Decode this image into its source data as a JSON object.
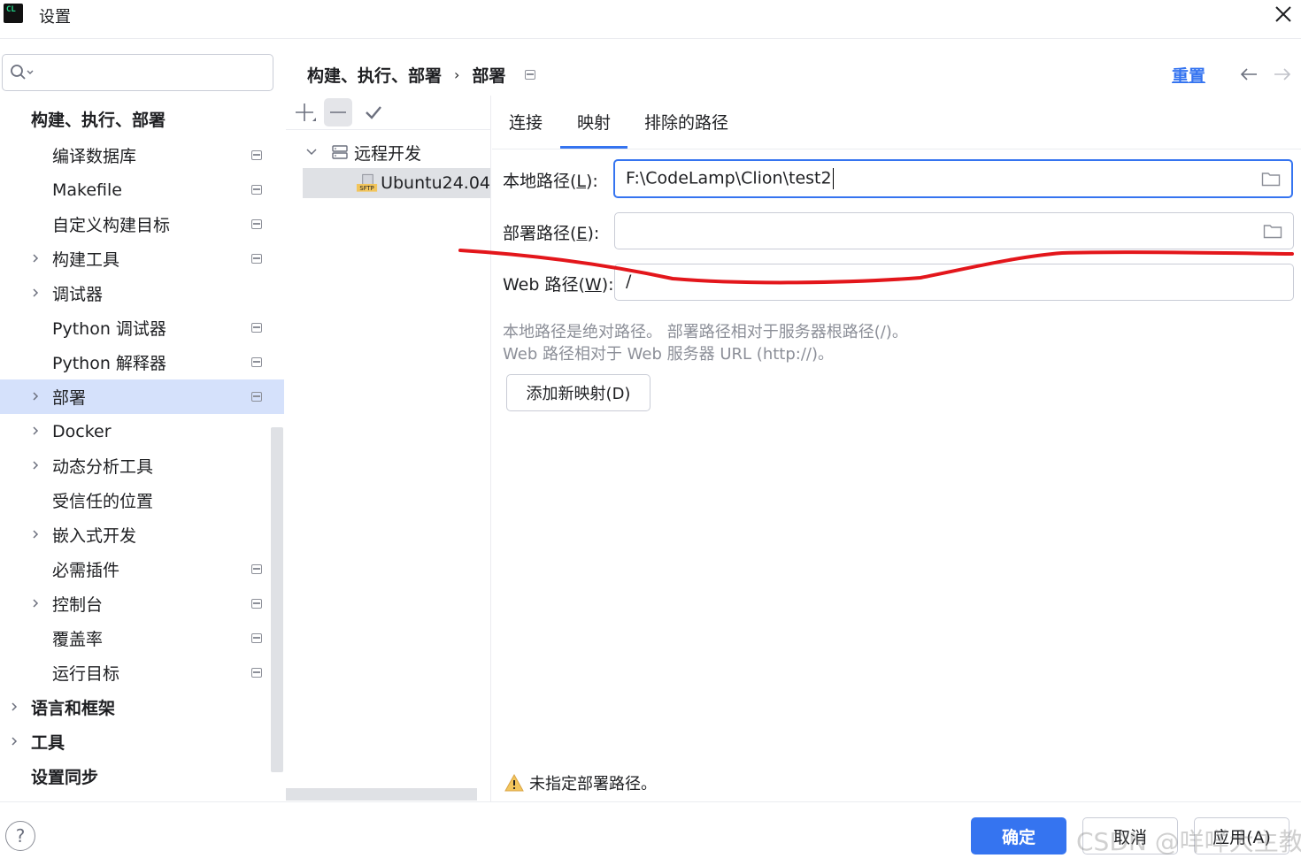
{
  "window": {
    "title": "设置",
    "logo_text": "CL"
  },
  "search": {
    "placeholder": ""
  },
  "sidebar": {
    "items": [
      {
        "label": "构建、执行、部署",
        "bold": true
      },
      {
        "label": "编译数据库"
      },
      {
        "label": "Makefile"
      },
      {
        "label": "自定义构建目标"
      },
      {
        "label": "构建工具"
      },
      {
        "label": "调试器"
      },
      {
        "label": "Python 调试器"
      },
      {
        "label": "Python 解释器"
      },
      {
        "label": "部署"
      },
      {
        "label": "Docker"
      },
      {
        "label": "动态分析工具"
      },
      {
        "label": "受信任的位置"
      },
      {
        "label": "嵌入式开发"
      },
      {
        "label": "必需插件"
      },
      {
        "label": "控制台"
      },
      {
        "label": "覆盖率"
      },
      {
        "label": "运行目标"
      },
      {
        "label": "语言和框架"
      },
      {
        "label": "工具"
      },
      {
        "label": "设置同步"
      }
    ]
  },
  "header": {
    "breadcrumb_parent": "构建、执行、部署",
    "breadcrumb_separator": "›",
    "breadcrumb_current": "部署",
    "reset_label": "重置"
  },
  "tree": {
    "group": "远程开发",
    "server": "Ubuntu24.04",
    "server_badge": "SFTP"
  },
  "tabs": [
    {
      "label": "连接"
    },
    {
      "label": "映射",
      "active": true
    },
    {
      "label": "排除的路径"
    }
  ],
  "form": {
    "local_path_label": "本地路径(",
    "local_path_mnemonic": "L",
    "local_path_value": "F:\\CodeLamp\\Clion\\test2",
    "deploy_path_label": "部署路径(",
    "deploy_path_mnemonic": "E",
    "deploy_path_value": "",
    "web_path_label": "Web 路径(",
    "web_path_mnemonic": "W",
    "web_path_value": "/",
    "label_suffix": "):",
    "hint_line1": "本地路径是绝对路径。 部署路径相对于服务器根路径(/)。",
    "hint_line2": "Web 路径相对于 Web 服务器 URL (http://)。",
    "add_mapping_label": "添加新映射(D)"
  },
  "warning": {
    "text": "未指定部署路径。",
    "color": "#f2c55c"
  },
  "footer": {
    "help_label": "?",
    "ok_label": "确定",
    "cancel_label": "取消",
    "apply_label": "应用(A)"
  },
  "watermark": "CSDN @咩咩大主教",
  "colors": {
    "accent": "#3574f0",
    "selection": "#d5e1fb",
    "annotation": "#e3161b"
  }
}
